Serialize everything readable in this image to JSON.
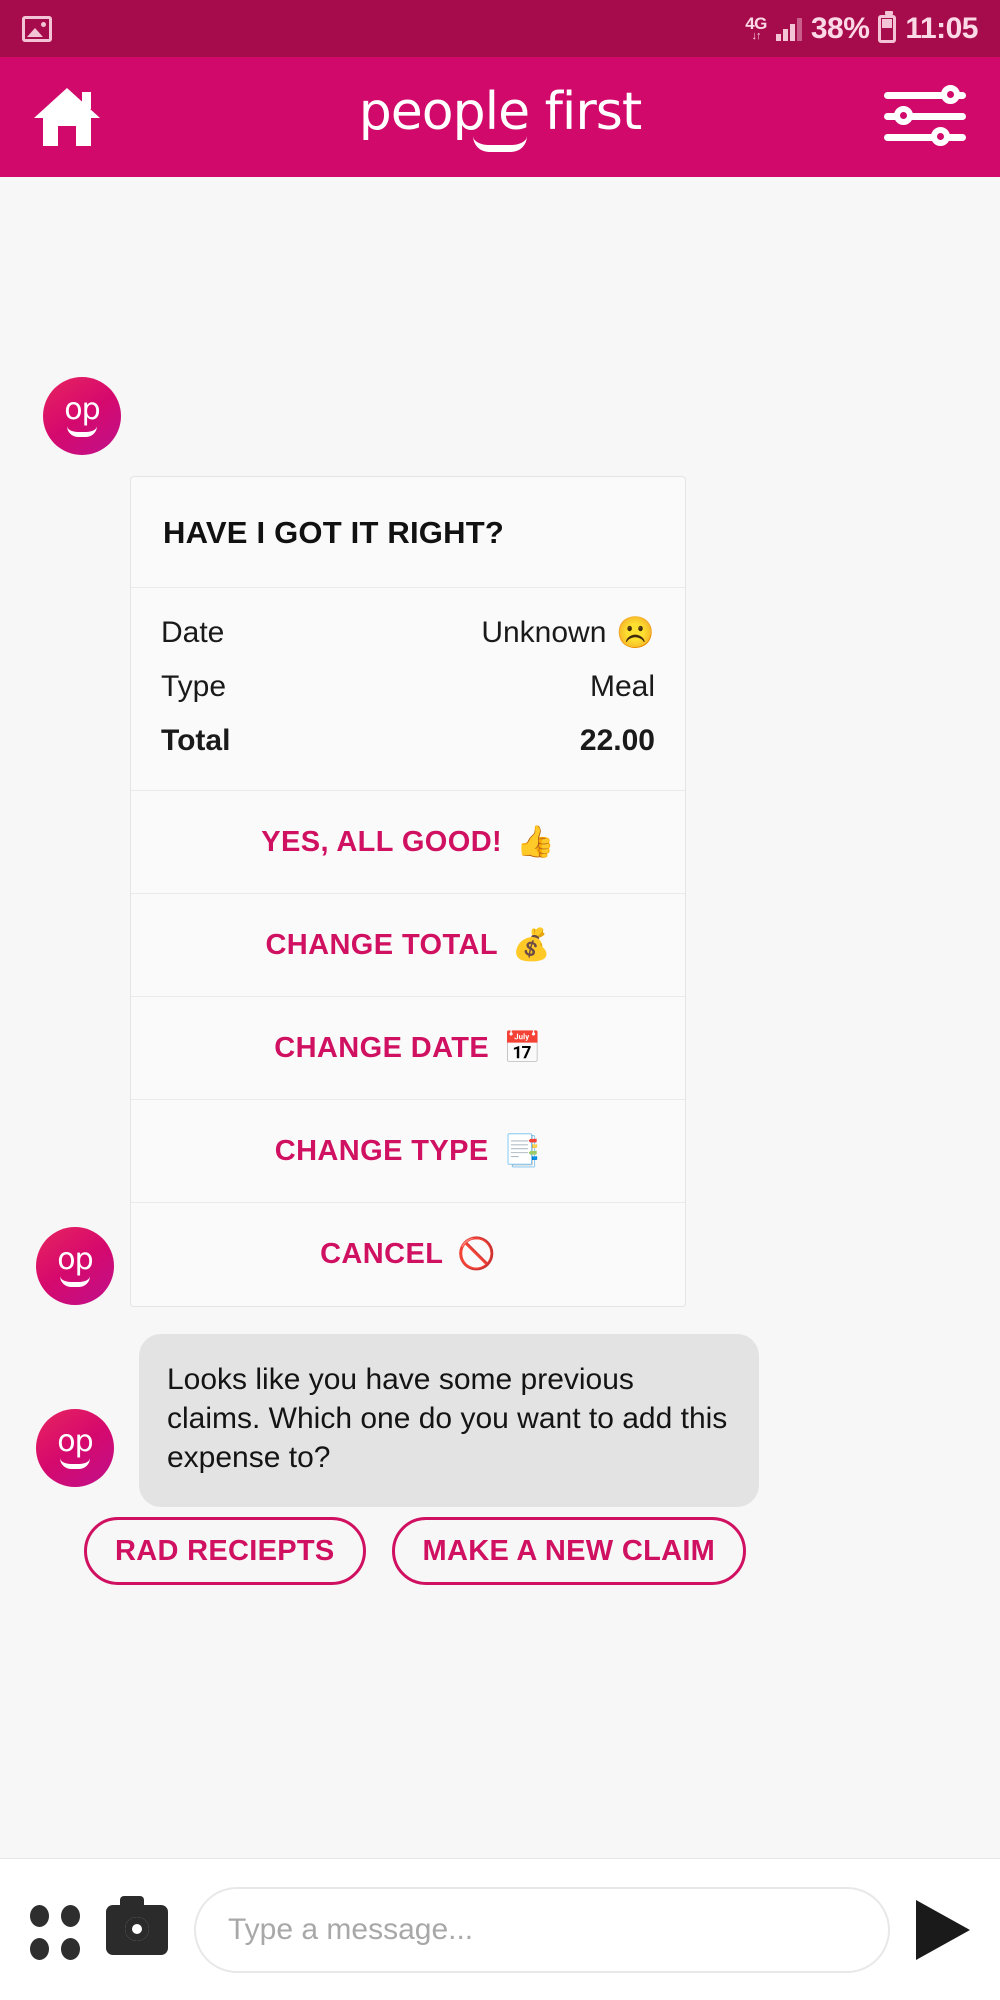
{
  "status_bar": {
    "photo_icon": "photo-icon",
    "network": "4G",
    "network_arrows": "↓↑",
    "battery_percent": "38%",
    "time": "11:05"
  },
  "app_bar": {
    "home_icon": "home-icon",
    "brand": "people first",
    "settings_icon": "sliders-icon",
    "background_color": "#d1096b"
  },
  "avatar": {
    "initials": "op"
  },
  "card": {
    "title": "HAVE I GOT IT RIGHT?",
    "details": [
      {
        "label": "Date",
        "value": "Unknown",
        "emoji": "☹️",
        "bold": false
      },
      {
        "label": "Type",
        "value": "Meal",
        "emoji": "",
        "bold": false
      },
      {
        "label": "Total",
        "value": "22.00",
        "emoji": "",
        "bold": true
      }
    ],
    "actions": [
      {
        "label": "YES, ALL GOOD!",
        "emoji": "👍"
      },
      {
        "label": "CHANGE TOTAL",
        "emoji": "💰"
      },
      {
        "label": "CHANGE DATE",
        "emoji": "📅"
      },
      {
        "label": "CHANGE TYPE",
        "emoji": "📑"
      },
      {
        "label": "CANCEL",
        "emoji": "🚫"
      }
    ],
    "accent_color": "#d01060"
  },
  "bubble": {
    "text": "Looks like you have some previous claims. Which one do you want to add this expense to?"
  },
  "quick_replies": [
    {
      "label": "RAD RECIEPTS"
    },
    {
      "label": "MAKE A NEW CLAIM"
    }
  ],
  "composer": {
    "grid_icon": "grid-icon",
    "camera_icon": "camera-icon",
    "placeholder": "Type a message...",
    "value": "",
    "send_icon": "send-icon"
  }
}
